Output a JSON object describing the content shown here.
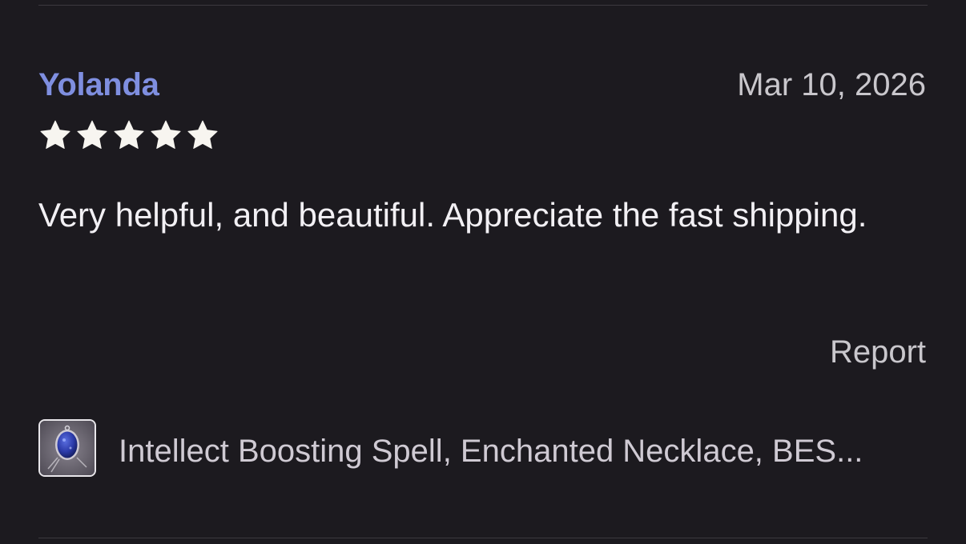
{
  "review": {
    "reviewer_name": "Yolanda",
    "date": "Mar 10, 2026",
    "rating": 5,
    "rating_max": 5,
    "star_icon": "star-icon",
    "text": "Very helpful, and beautiful. Appreciate the fast shipping.",
    "report_label": "Report"
  },
  "item": {
    "title": "Intellect Boosting Spell, Enchanted Necklace, BES...",
    "thumbnail_icon": "necklace-thumbnail"
  },
  "colors": {
    "background": "#1c1a1f",
    "reviewer_name": "#7f8fe0",
    "star": "#f7f5f0",
    "body_text": "#f2f0f4",
    "muted_text": "#c9c7cc",
    "divider": "#3c393f"
  }
}
